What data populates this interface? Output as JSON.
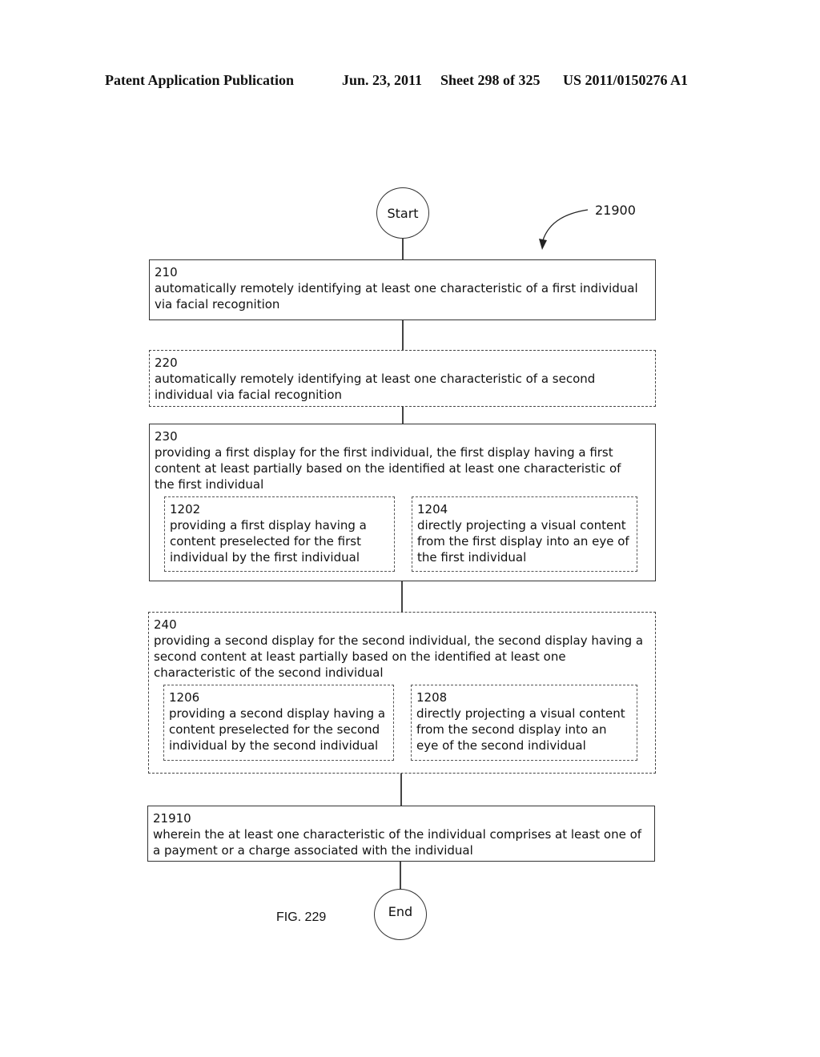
{
  "header": {
    "publication": "Patent Application Publication",
    "date": "Jun. 23, 2011",
    "sheet": "Sheet 298 of 325",
    "patent_number": "US 2011/0150276 A1"
  },
  "diagram": {
    "reference_number": "21900",
    "start_label": "Start",
    "end_label": "End",
    "figure_label": "FIG. 229",
    "steps": [
      {
        "id": "210",
        "text": "automatically remotely identifying at least one characteristic of a first individual via facial recognition",
        "style": "solid"
      },
      {
        "id": "220",
        "text": "automatically remotely identifying at least one characteristic of a second individual via facial recognition",
        "style": "dashed"
      },
      {
        "id": "230",
        "text": "providing a first display for the first individual, the first display having a first content at least partially based on the identified at least one characteristic of the first individual",
        "style": "solid",
        "substeps": [
          {
            "id": "1202",
            "text": "providing a first display having a content preselected for the first individual by the first individual"
          },
          {
            "id": "1204",
            "text": "directly projecting a visual content from the first display into an eye of the first individual"
          }
        ]
      },
      {
        "id": "240",
        "text": "providing a second display for the second individual, the second display having a second content at least partially based on the identified at least one characteristic of the second individual",
        "style": "dashed",
        "substeps": [
          {
            "id": "1206",
            "text": "providing a second display having a content preselected for the second individual by the second individual"
          },
          {
            "id": "1208",
            "text": "directly projecting a visual content from the second display into an eye of the second individual"
          }
        ]
      },
      {
        "id": "21910",
        "text": "wherein the at least one characteristic of the individual comprises at least one of a payment or a charge associated with the individual",
        "style": "solid"
      }
    ]
  }
}
